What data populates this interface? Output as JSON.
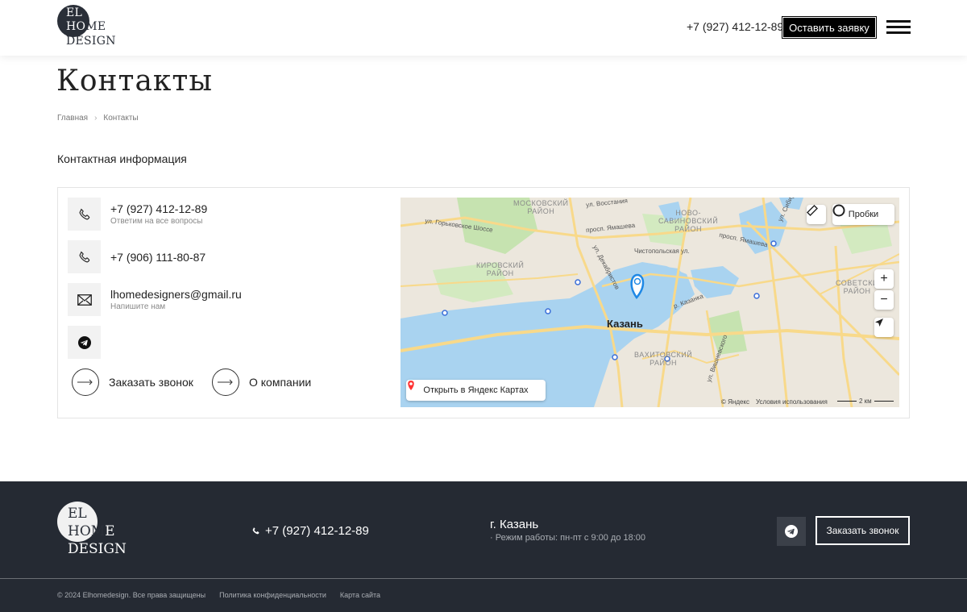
{
  "header": {
    "logo": {
      "line1": "EL",
      "line2a": "HO",
      "line2b": "ME",
      "line3": "DESIGN"
    },
    "phone": "+7 (927) 412-12-89",
    "cta_label": "Оставить заявку"
  },
  "page": {
    "title": "Контакты",
    "breadcrumbs": [
      "Главная",
      "Контакты"
    ],
    "section_title": "Контактная информация"
  },
  "contacts": [
    {
      "icon": "phone-icon",
      "main": "+7 (927) 412-12-89",
      "sub": "Ответим на все вопросы"
    },
    {
      "icon": "phone-icon",
      "main": "+7 (906) 111-80-87",
      "sub": ""
    },
    {
      "icon": "mail-icon",
      "main": "lhomedesigners@gmail.ru",
      "sub": "Напишите нам"
    },
    {
      "icon": "telegram-icon",
      "main": "",
      "sub": ""
    }
  ],
  "links": {
    "callback": "Заказать звонок",
    "about": "О компании"
  },
  "map": {
    "city": "Казань",
    "districts": {
      "moskovsky": "МОСКОВСКИЙ\nРАЙОН",
      "novo": "НОВО-\nСАВИНОВСКИЙ\nРАЙОН",
      "kirovsky": "КИРОВСКИЙ\nРАЙОН",
      "sovetsky": "СОВЕТСКИ\nРАЙОН",
      "vakhitovsky": "ВАХИТОВСКИЙ\nРАЙОН"
    },
    "streets": {
      "gorkovskoe": "ул. Горьковское Шоссе",
      "yamasheva": "просп. Ямашева",
      "yamasheva2": "просп. Ямашева",
      "dekabristov": "ул. Декабристов",
      "chistopolskaya": "Чистопольская ул.",
      "vishnevskogo": "ул. Вишневского",
      "kazanka": "р. Казанка",
      "vosstaniya": "ул. Восстания",
      "sibirsky": "ул. Сибир"
    },
    "traffic_label": "Пробки",
    "open_label": "Открыть в Яндекс Картах",
    "copyright": "© Яндекс",
    "terms": "Условия использования",
    "scale": "2 км",
    "colors": {
      "water": "#a9d3f0",
      "road": "#f8d98a",
      "green": "#c6e3b0",
      "land": "#ece7dd"
    }
  },
  "footer": {
    "logo": {
      "line1": "EL",
      "line2a": "HOM",
      "line2b": "E",
      "line3": "DESIGN"
    },
    "phone": "+7 (927) 412-12-89",
    "city": "г. Казань",
    "hours": "· Режим работы: пн-пт с 9:00 до 18:00",
    "cta_label": "Заказать звонок",
    "copyright": "© 2024 Elhomedesign. Все права защищены",
    "privacy": "Политика конфиденциальности",
    "sitemap": "Карта сайта"
  }
}
